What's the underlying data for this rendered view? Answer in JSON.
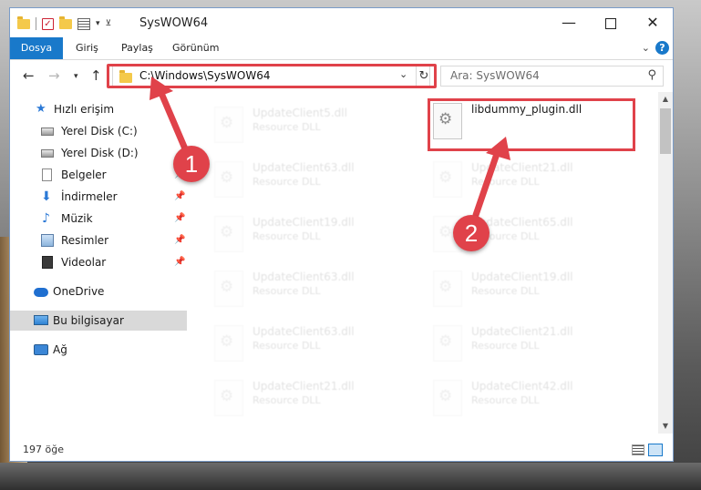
{
  "window": {
    "title": "SysWOW64",
    "min_glyph": "—",
    "close_glyph": "✕"
  },
  "ribbon": {
    "tabs": [
      "Dosya",
      "Giriş",
      "Paylaş",
      "Görünüm"
    ]
  },
  "nav": {
    "back_glyph": "←",
    "forward_glyph": "→",
    "recent_glyph": "▾",
    "up_glyph": "↑",
    "address": "C:\\Windows\\SysWOW64",
    "search_placeholder": "Ara: SysWOW64"
  },
  "sidebar": {
    "items": [
      {
        "label": "Hızlı erişim",
        "icon": "star-icon",
        "pinned": false
      },
      {
        "label": "Yerel Disk (C:)",
        "icon": "drive-icon",
        "pinned": false
      },
      {
        "label": "Yerel Disk (D:)",
        "icon": "drive-icon",
        "pinned": false
      },
      {
        "label": "Belgeler",
        "icon": "document-icon",
        "pinned": true
      },
      {
        "label": "İndirmeler",
        "icon": "download-icon",
        "pinned": true
      },
      {
        "label": "Müzik",
        "icon": "music-icon",
        "pinned": true
      },
      {
        "label": "Resimler",
        "icon": "pictures-icon",
        "pinned": true
      },
      {
        "label": "Videolar",
        "icon": "video-icon",
        "pinned": true
      },
      {
        "label": "OneDrive",
        "icon": "onedrive-icon",
        "pinned": false
      },
      {
        "label": "Bu bilgisayar",
        "icon": "computer-icon",
        "pinned": false,
        "selected": true
      },
      {
        "label": "Ağ",
        "icon": "network-icon",
        "pinned": false
      }
    ]
  },
  "files": {
    "highlighted": {
      "name": "libdummy_plugin.dll",
      "type": ""
    },
    "faded": [
      {
        "name": "UpdateClient5.dll",
        "type": "Resource DLL"
      },
      {
        "name": "UpdateClient63.dll",
        "type": "Resource DLL"
      },
      {
        "name": "UpdateClient21.dll",
        "type": "Resource DLL"
      },
      {
        "name": "UpdateClient19.dll",
        "type": "Resource DLL"
      },
      {
        "name": "UpdateClient65.dll",
        "type": "Resource DLL"
      },
      {
        "name": "UpdateClient63.dll",
        "type": "Resource DLL"
      },
      {
        "name": "UpdateClient19.dll",
        "type": "Resource DLL"
      },
      {
        "name": "UpdateClient63.dll",
        "type": "Resource DLL"
      },
      {
        "name": "UpdateClient21.dll",
        "type": "Resource DLL"
      },
      {
        "name": "UpdateClient21.dll",
        "type": "Resource DLL"
      },
      {
        "name": "UpdateClient42.dll",
        "type": "Resource DLL"
      }
    ]
  },
  "status": {
    "item_count": "197 öğe"
  },
  "annotations": {
    "step1": "1",
    "step2": "2",
    "color": "#e0424a"
  }
}
